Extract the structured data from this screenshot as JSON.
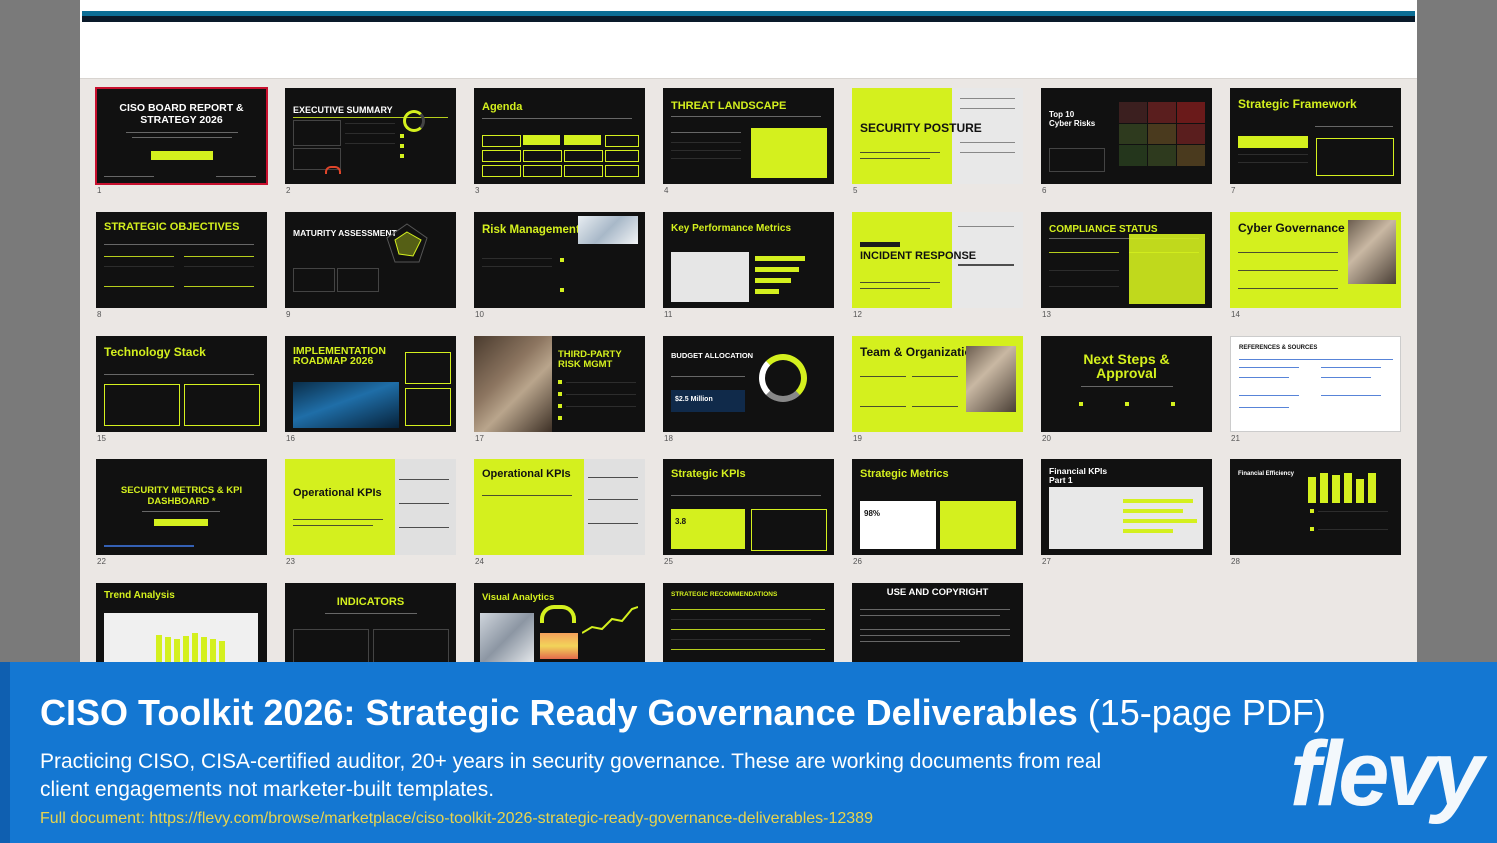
{
  "slides": [
    {
      "num": "1",
      "title": "CISO BOARD REPORT & STRATEGY 2026",
      "style": "dark-center",
      "selected": true
    },
    {
      "num": "2",
      "title": "EXECUTIVE SUMMARY",
      "style": "dark"
    },
    {
      "num": "3",
      "title": "Agenda",
      "style": "dark"
    },
    {
      "num": "4",
      "title": "THREAT LANDSCAPE",
      "style": "dark"
    },
    {
      "num": "5",
      "title": "SECURITY POSTURE",
      "style": "lime-left"
    },
    {
      "num": "6",
      "title": "Top 10 Cyber Risks",
      "style": "dark-white"
    },
    {
      "num": "7",
      "title": "Strategic Framework",
      "style": "dark"
    },
    {
      "num": "8",
      "title": "STRATEGIC OBJECTIVES",
      "style": "dark"
    },
    {
      "num": "9",
      "title": "MATURITY ASSESSMENT",
      "style": "dark-white"
    },
    {
      "num": "10",
      "title": "Risk Management",
      "style": "dark"
    },
    {
      "num": "11",
      "title": "Key Performance Metrics",
      "style": "dark"
    },
    {
      "num": "12",
      "title": "INCIDENT RESPONSE",
      "style": "lime-left"
    },
    {
      "num": "13",
      "title": "COMPLIANCE STATUS",
      "style": "dark"
    },
    {
      "num": "14",
      "title": "Cyber Governance",
      "style": "lime-photo"
    },
    {
      "num": "15",
      "title": "Technology Stack",
      "style": "dark"
    },
    {
      "num": "16",
      "title": "IMPLEMENTATION ROADMAP 2026",
      "style": "dark"
    },
    {
      "num": "17",
      "title": "THIRD-PARTY RISK MGMT",
      "style": "photo-left"
    },
    {
      "num": "18",
      "title": "BUDGET ALLOCATION",
      "style": "dark"
    },
    {
      "num": "19",
      "title": "Team & Organization",
      "style": "lime-photo"
    },
    {
      "num": "20",
      "title": "Next Steps & Approval",
      "style": "dark-center-lime"
    },
    {
      "num": "21",
      "title": "REFERENCES & SOURCES",
      "style": "white"
    },
    {
      "num": "22",
      "title": "SECURITY METRICS & KPI DASHBOARD *",
      "style": "dark-center-lime"
    },
    {
      "num": "23",
      "title": "Operational KPIs",
      "style": "lime-left"
    },
    {
      "num": "24",
      "title": "Operational KPIs",
      "style": "lime-left"
    },
    {
      "num": "25",
      "title": "Strategic KPIs",
      "style": "dark"
    },
    {
      "num": "26",
      "title": "Strategic Metrics",
      "style": "dark"
    },
    {
      "num": "27",
      "title": "Financial KPIs Part 1",
      "style": "dark"
    },
    {
      "num": "28",
      "title": "Financial Efficiency",
      "style": "dark"
    },
    {
      "num": "",
      "title": "Trend Analysis",
      "style": "lime-top"
    },
    {
      "num": "",
      "title": "INDICATORS",
      "style": "dark-center-lime"
    },
    {
      "num": "",
      "title": "Visual Analytics",
      "style": "dark"
    },
    {
      "num": "",
      "title": "STRATEGIC RECOMMENDATIONS",
      "style": "dark"
    },
    {
      "num": "",
      "title": "USE AND COPYRIGHT",
      "style": "dark-center"
    }
  ],
  "slide_details": {
    "s1_button": "",
    "s6_small": "",
    "s11_value": "",
    "s18_amount": "$2.5 Million",
    "s25_value": "3.8",
    "s26_value": "98%"
  },
  "banner": {
    "title": "CISO Toolkit 2026: Strategic Ready Governance Deliverables",
    "title_suffix": "(15-page PDF)",
    "description": "Practicing CISO, CISA-certified auditor, 20+ years in security governance. These are working documents from real client engagements not marketer-built templates.",
    "link": "Full document: https://flevy.com/browse/marketplace/ciso-toolkit-2026-strategic-ready-governance-deliverables-12389",
    "logo": "flevy"
  },
  "colors": {
    "accent": "#d4f01e",
    "banner": "#1477d2",
    "dark": "#111111",
    "link": "#e8d44d"
  }
}
